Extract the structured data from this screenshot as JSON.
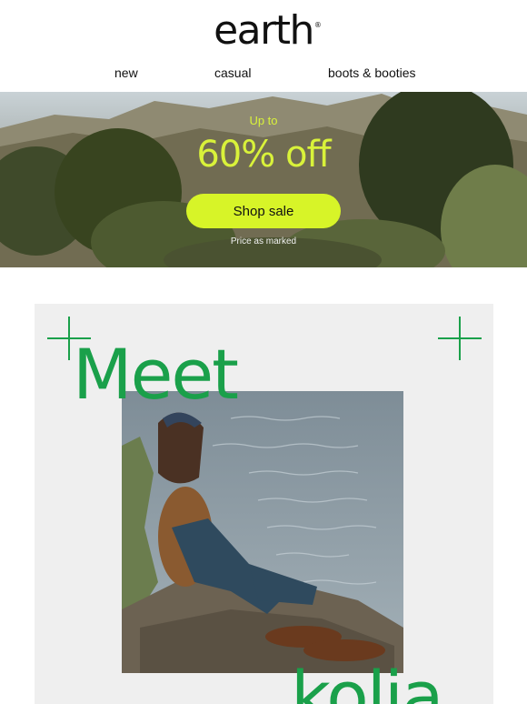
{
  "brand": {
    "name": "earth",
    "registered_mark": "®"
  },
  "nav": {
    "items": [
      {
        "label": "new"
      },
      {
        "label": "casual"
      },
      {
        "label": "boots & booties"
      }
    ]
  },
  "hero": {
    "eyebrow": "Up to",
    "headline": "60% off",
    "cta_label": "Shop sale",
    "note": "Price as marked",
    "accent_color": "#d7f428"
  },
  "feature": {
    "headline_line1": "Meet",
    "headline_line2": "kolia",
    "accent_color": "#1aa04a",
    "icons": [
      "plus-icon",
      "plus-icon"
    ]
  }
}
